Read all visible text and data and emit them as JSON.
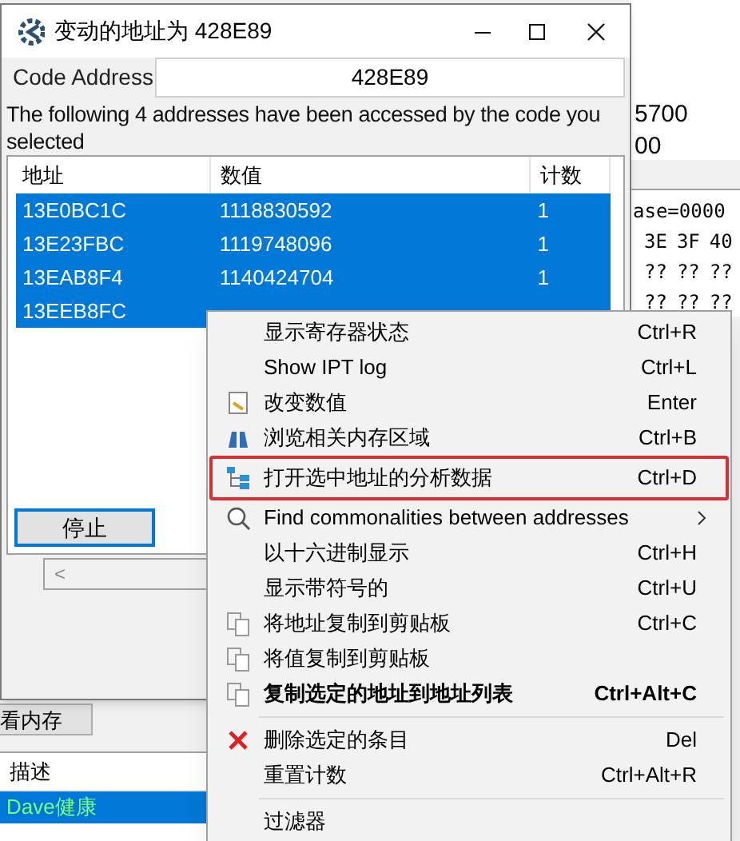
{
  "background_window": {
    "value_1": "5700",
    "value_2": "00",
    "hex_address": "ase=0000",
    "hex_columns": [
      "3E",
      "3F",
      "40"
    ],
    "hex_rows": [
      [
        "??",
        "??",
        "??"
      ],
      [
        "??",
        "??",
        "??"
      ]
    ],
    "memory_button": "看内存",
    "list": {
      "header": "描述",
      "rows": [
        {
          "text": "Dave健康",
          "selected": true
        }
      ]
    }
  },
  "dialog": {
    "title": "变动的地址为 428E89",
    "code_address_label": "Code Address",
    "code_address_value": "428E89",
    "message": "The following 4 addresses have been accessed by the code you selected",
    "table": {
      "columns": [
        "地址",
        "数值",
        "计数"
      ],
      "rows": [
        {
          "cells": [
            "13E0BC1C",
            "1118830592",
            "1"
          ],
          "selected": true
        },
        {
          "cells": [
            "13E23FBC",
            "1119748096",
            "1"
          ],
          "selected": true
        },
        {
          "cells": [
            "13EAB8F4",
            "1140424704",
            "1"
          ],
          "selected": true
        },
        {
          "cells": [
            "13EEB8FC"
          ],
          "selected": true
        }
      ]
    },
    "stop_button": "停止",
    "scroll_left": "<"
  },
  "context_menu": {
    "items": [
      {
        "kind": "plain",
        "label": "显示寄存器状态",
        "shortcut": "Ctrl+R"
      },
      {
        "kind": "plain",
        "label": "Show IPT log",
        "shortcut": "Ctrl+L"
      },
      {
        "kind": "edit",
        "label": "改变数值",
        "shortcut": "Enter"
      },
      {
        "kind": "browse",
        "label": "浏览相关内存区域",
        "shortcut": "Ctrl+B"
      },
      {
        "kind": "analyze",
        "label": "打开选中地址的分析数据",
        "shortcut": "Ctrl+D",
        "outlined": true
      },
      {
        "kind": "find",
        "label": "Find commonalities between addresses",
        "submenu": true
      },
      {
        "kind": "plain",
        "label": "以十六进制显示",
        "shortcut": "Ctrl+H"
      },
      {
        "kind": "plain",
        "label": "显示带符号的",
        "shortcut": "Ctrl+U"
      },
      {
        "kind": "copy",
        "label": "将地址复制到剪贴板",
        "shortcut": "Ctrl+C"
      },
      {
        "kind": "copy",
        "label": "将值复制到剪贴板"
      },
      {
        "kind": "copy",
        "label": "复制选定的地址到地址列表",
        "shortcut": "Ctrl+Alt+C",
        "bold": true
      },
      {
        "kind": "separator"
      },
      {
        "kind": "delete",
        "label": "删除选定的条目",
        "shortcut": "Del"
      },
      {
        "kind": "plain",
        "label": "重置计数",
        "shortcut": "Ctrl+Alt+R"
      },
      {
        "kind": "separator"
      },
      {
        "kind": "plain",
        "label": "过滤器"
      }
    ]
  }
}
